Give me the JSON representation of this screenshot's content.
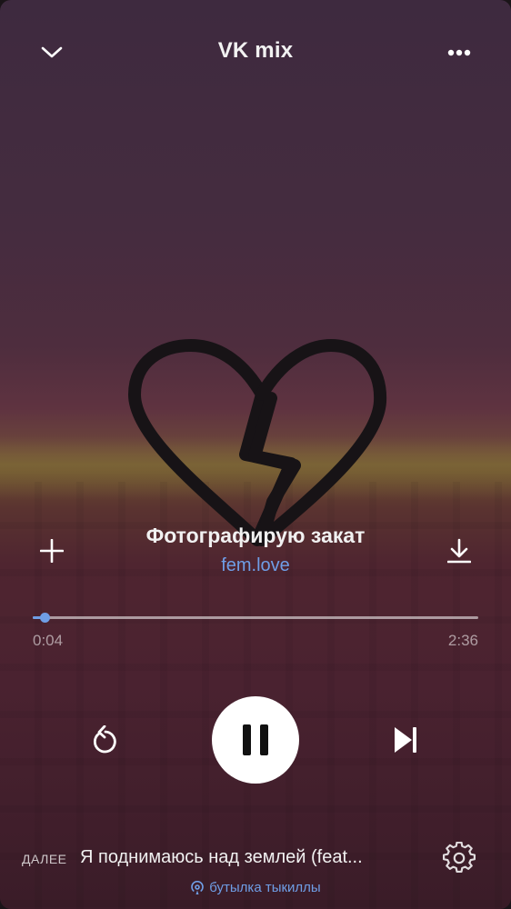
{
  "header": {
    "title": "VK mix",
    "collapse_icon": "chevron-down-icon",
    "more_icon": "more-horizontal-icon"
  },
  "track": {
    "title": "Фотографирую закат",
    "artist": "fem.love",
    "add_icon": "plus-icon",
    "download_icon": "download-icon"
  },
  "progress": {
    "elapsed": "0:04",
    "duration": "2:36",
    "fraction": 0.026
  },
  "controls": {
    "repeat_icon": "repeat-icon",
    "pause_icon": "pause-icon",
    "next_icon": "skip-next-icon"
  },
  "next_up": {
    "label": "ДАЛЕЕ",
    "track": "Я поднимаюсь над землей (feat...",
    "settings_icon": "gear-icon"
  },
  "broadcast": {
    "text": "бутылка тыкиллы",
    "icon": "broadcast-icon"
  },
  "colors": {
    "accent": "#6f9ee6",
    "text": "#f1f1f1",
    "play_button": "#ffffff"
  }
}
